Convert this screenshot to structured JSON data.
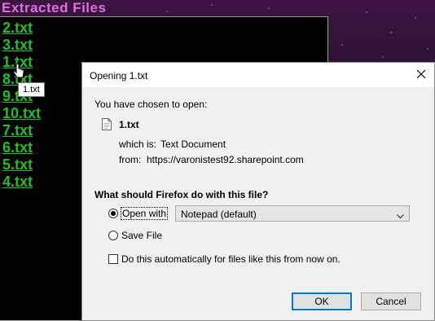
{
  "page": {
    "title": "Extracted Files",
    "files": [
      "2.txt",
      "3.txt",
      "1.txt",
      "8.txt",
      "9.txt",
      "10.txt",
      "7.txt",
      "6.txt",
      "5.txt",
      "4.txt"
    ],
    "tooltip": "1.txt"
  },
  "dialog": {
    "title": "Opening 1.txt",
    "intro": "You have chosen to open:",
    "file_name": "1.txt",
    "which_is_label": "which is:",
    "which_is_value": "Text Document",
    "from_label": "from:",
    "from_value": "https://varonistest92.sharepoint.com",
    "question": "What should Firefox do with this file?",
    "open_with_label": "Open with",
    "open_with_app": "Notepad (default)",
    "save_file_label": "Save File",
    "auto_label": "Do this automatically for files like this from now on.",
    "ok_label": "OK",
    "cancel_label": "Cancel"
  },
  "colors": {
    "link": "#1fc21f",
    "title": "#e070e0",
    "accent": "#0078d7"
  }
}
